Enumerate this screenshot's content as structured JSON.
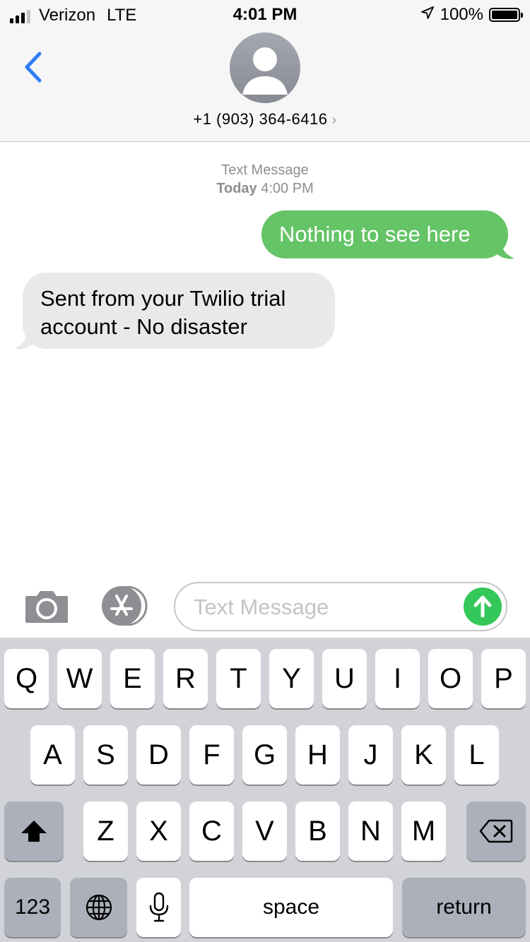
{
  "status_bar": {
    "carrier": "Verizon",
    "network": "LTE",
    "time": "4:01 PM",
    "battery": "100%"
  },
  "header": {
    "contact": "+1 (903) 364-6416",
    "chevron": "›"
  },
  "thread": {
    "stamp_label": "Text Message",
    "stamp_day": "Today",
    "stamp_time": "4:00 PM",
    "messages": [
      {
        "direction": "sent",
        "text": "Nothing to see here"
      },
      {
        "direction": "received",
        "line1": "Sent from your Twilio trial",
        "line2": "account - No disaster"
      }
    ]
  },
  "composer": {
    "placeholder": "Text Message"
  },
  "keyboard": {
    "row1": [
      "Q",
      "W",
      "E",
      "R",
      "T",
      "Y",
      "U",
      "I",
      "O",
      "P"
    ],
    "row2": [
      "A",
      "S",
      "D",
      "F",
      "G",
      "H",
      "J",
      "K",
      "L"
    ],
    "row3": [
      "Z",
      "X",
      "C",
      "V",
      "B",
      "N",
      "M"
    ],
    "numbers_label": "123",
    "space_label": "space",
    "return_label": "return"
  },
  "colors": {
    "sent_bubble": "#65c466",
    "received_bubble": "#e9e9eb",
    "accent_blue": "#2f7cf6",
    "send_button": "#34c759"
  },
  "icons": [
    "cellular-signal-icon",
    "location-arrow-icon",
    "battery-icon",
    "back-chevron-icon",
    "contact-avatar-icon",
    "camera-icon",
    "app-store-icon",
    "send-arrow-icon",
    "shift-icon",
    "delete-icon",
    "globe-icon",
    "microphone-icon"
  ]
}
